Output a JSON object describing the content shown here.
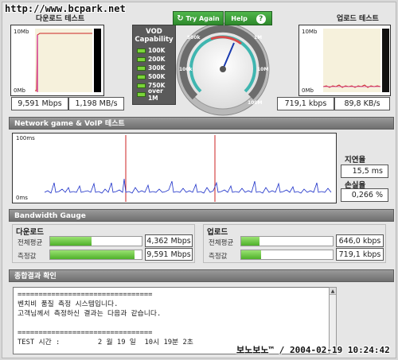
{
  "watermark": "http://www.bcpark.net",
  "download": {
    "title": "다운로드 테스트",
    "top_label": "10Mb",
    "bottom_label": "0Mb",
    "mbps": "9,591 Mbps",
    "mbs": "1,198 MB/s"
  },
  "upload": {
    "title": "업로드 테스트",
    "top_label": "10Mb",
    "bottom_label": "0Mb",
    "kbps": "719,1 kbps",
    "kbs": "89,8 KB/s"
  },
  "vod": {
    "title1": "VOD",
    "title2": "Capability",
    "levels": [
      "100K",
      "200K",
      "300K",
      "500K",
      "750K",
      "over 1M"
    ]
  },
  "gauge": {
    "try_again": "Try Again",
    "help": "Help",
    "help_icon": "question-icon",
    "ticks": [
      "100k",
      "500k",
      "1M",
      "10M",
      "100M"
    ]
  },
  "network": {
    "section_title": "Network game & VoIP 테스트",
    "top_label": "100ms",
    "bottom_label": "0ms",
    "latency_label": "지연율",
    "latency_value": "15,5 ms",
    "loss_label": "손실율",
    "loss_value": "0,266 %"
  },
  "bandwidth": {
    "section_title": "Bandwidth Gauge",
    "download": {
      "title": "다운로드",
      "avg_label": "전체평균",
      "avg_value": "4,362 Mbps",
      "avg_fraction": 0.45,
      "meas_label": "측정값",
      "meas_value": "9,591 Mbps",
      "meas_fraction": 0.92
    },
    "upload": {
      "title": "업로드",
      "avg_label": "전체평균",
      "avg_value": "646,0 kbps",
      "avg_fraction": 0.2,
      "meas_label": "측정값",
      "meas_value": "719,1 kbps",
      "meas_fraction": 0.22
    }
  },
  "summary": {
    "section_title": "종합결과 확인",
    "text": "================================\n벤치비 품질 측정 시스템입니다.\n고객님께서 측정하신 결과는 다음과 같습니다.\n\n================================\nTEST 시간 :         2 월 19 일  10시 19분 2초"
  },
  "footer": "보노보노™ / 2004-02-19 10:24:42",
  "colors": {
    "accent_green": "#3aa33a",
    "graph_red": "#cc2222",
    "graph_blue": "#1a2ec8"
  }
}
